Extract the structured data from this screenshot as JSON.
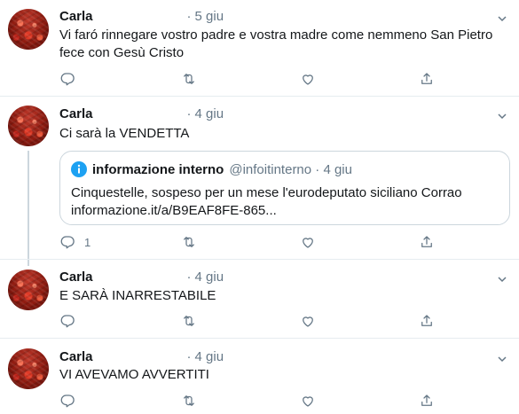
{
  "tweets": [
    {
      "name": "Carla",
      "dot": "·",
      "date": "5 giu",
      "text": "Vi faró rinnegare vostro padre e vostra madre come nemmeno San Pietro fece con Gesù Cristo",
      "reply_count": "",
      "actions": [
        "reply-icon",
        "retweet-icon",
        "like-icon",
        "share-icon"
      ]
    },
    {
      "name": "Carla",
      "dot": "·",
      "date": "4 giu",
      "text": "Ci sarà la VENDETTA",
      "reply_count": "1",
      "quote": {
        "name": "informazione interno",
        "handle": "@infoitinterno · 4 giu",
        "text": "Cinquestelle, sospeso per un mese l'eurodeputato siciliano Corrao informazione.it/a/B9EAF8FE-865..."
      }
    },
    {
      "name": "Carla",
      "dot": "·",
      "date": "4 giu",
      "text": "E SARÀ INARRESTABILE",
      "reply_count": ""
    },
    {
      "name": "Carla",
      "dot": "·",
      "date": "4 giu",
      "text": "VI AVEVAMO AVVERTITI",
      "reply_count": ""
    }
  ],
  "colors": {
    "text": "#14171a",
    "secondary": "#657786",
    "border": "#e6ecf0",
    "thread": "#ccd6dd",
    "info_blue": "#1da1f2"
  }
}
